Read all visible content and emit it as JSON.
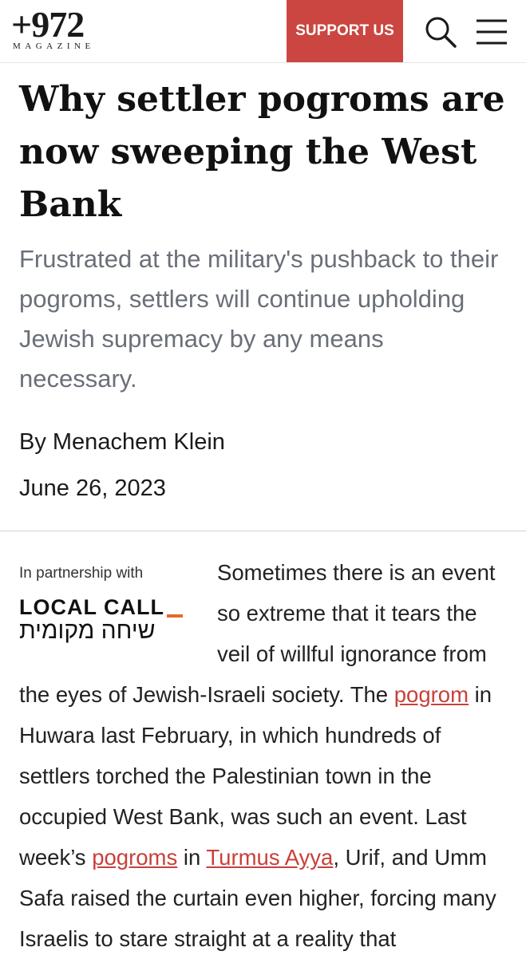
{
  "header": {
    "logo_main": "+972",
    "logo_sub": "MAGAZINE",
    "support_label": "SUPPORT US",
    "brand_color": "#cb4641"
  },
  "article": {
    "title": "Why settler pogroms are now sweeping the West Bank",
    "subtitle": "Frustrated at the military's pushback to their pogroms, settlers will continue upholding Jewish supremacy by any means necessary.",
    "byline": "By Menachem Klein",
    "date": "June 26, 2023"
  },
  "partner": {
    "label": "In partnership with",
    "name": "LOCAL CALL",
    "name_hebrew": "שיחה מקומית"
  },
  "body": {
    "t1": "Sometimes there is an event so extreme that it tears the veil of willful ignorance from the eyes of Jewish-Israeli society. The ",
    "link1": "pogrom",
    "t2": " in Huwara last February, in which hundreds of settlers torched the Palestinian town in the occupied West Bank, was such an event. Last week’s ",
    "link2": "pogroms",
    "t3": " in ",
    "link3": "Turmus Ayya",
    "t4": ", Urif, and Umm Safa raised the curtain even higher, forcing many Israelis to stare straight at a reality that"
  },
  "icons": {
    "search": "search-icon",
    "menu": "hamburger-menu-icon"
  },
  "colors": {
    "link": "#c8403b",
    "subtitle": "#6a6f78",
    "local_call_accent": "#e26a2c"
  }
}
